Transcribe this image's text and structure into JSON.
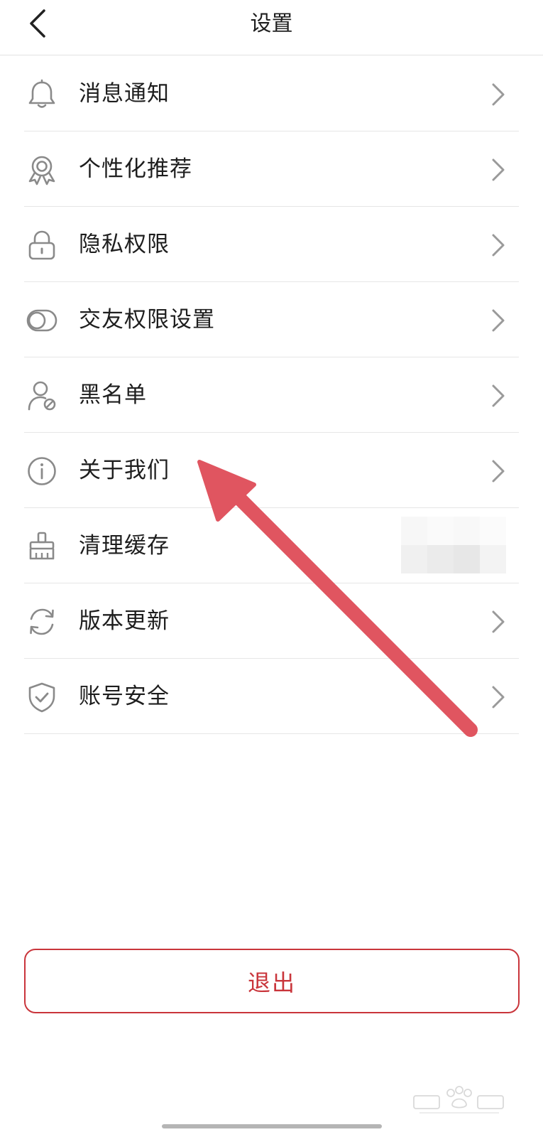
{
  "header": {
    "title": "设置"
  },
  "menu": {
    "items": [
      {
        "label": "消息通知",
        "icon": "bell-icon",
        "has_chevron": true
      },
      {
        "label": "个性化推荐",
        "icon": "award-icon",
        "has_chevron": true
      },
      {
        "label": "隐私权限",
        "icon": "lock-icon",
        "has_chevron": true
      },
      {
        "label": "交友权限设置",
        "icon": "toggle-icon",
        "has_chevron": true
      },
      {
        "label": "黑名单",
        "icon": "user-block-icon",
        "has_chevron": true
      },
      {
        "label": "关于我们",
        "icon": "info-icon",
        "has_chevron": true
      },
      {
        "label": "清理缓存",
        "icon": "broom-icon",
        "has_chevron": false
      },
      {
        "label": "版本更新",
        "icon": "refresh-icon",
        "has_chevron": true
      },
      {
        "label": "账号安全",
        "icon": "shield-check-icon",
        "has_chevron": true
      }
    ]
  },
  "logout": {
    "label": "退出"
  },
  "colors": {
    "accent": "#c9353b",
    "annotation_arrow": "#e05560",
    "icon": "#8a8a8a",
    "divider": "#e6e6e6"
  }
}
